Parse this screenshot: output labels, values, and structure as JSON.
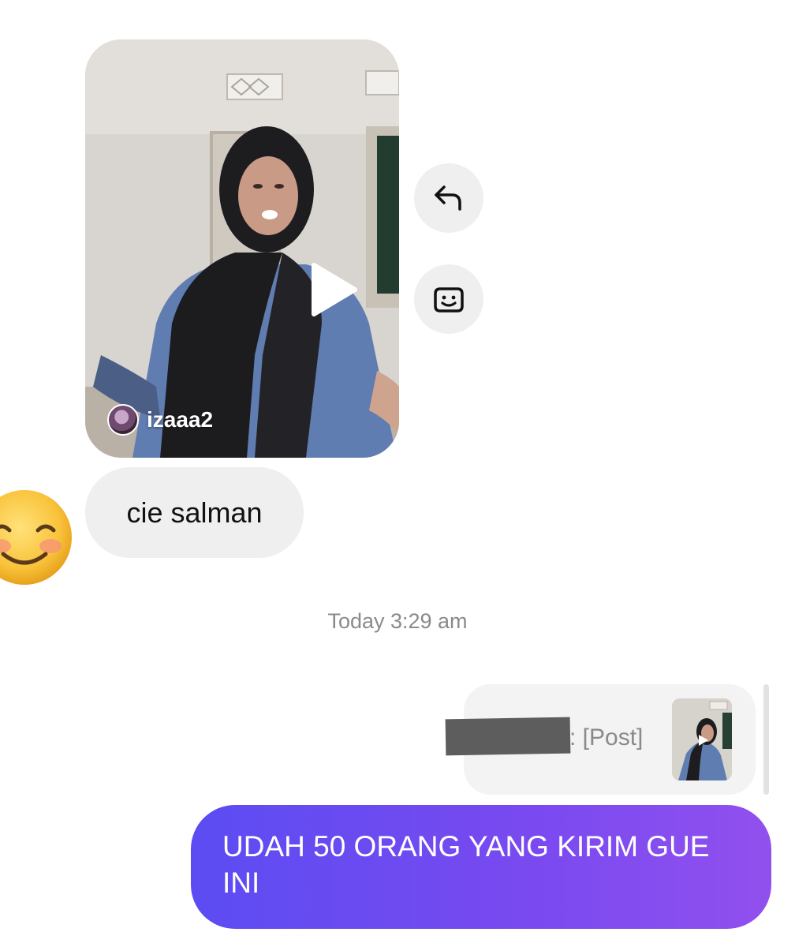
{
  "shared_post": {
    "author": "izaaa2"
  },
  "messages": {
    "received_text": "cie salman",
    "timestamp": "Today 3:29 am",
    "reply_ref_text": ": [Post]",
    "sent_text": "UDAH 50 ORANG YANG KIRIM GUE INI"
  },
  "icons": {
    "reply": "reply-arrow-icon",
    "react": "smiley-react-icon",
    "play": "play-icon",
    "avatar": "smiling-face-emoji"
  },
  "colors": {
    "bubble_in": "#efefef",
    "bubble_out_start": "#5b4cf2",
    "bubble_out_end": "#9150ee",
    "timestamp": "#8a8a8a"
  }
}
